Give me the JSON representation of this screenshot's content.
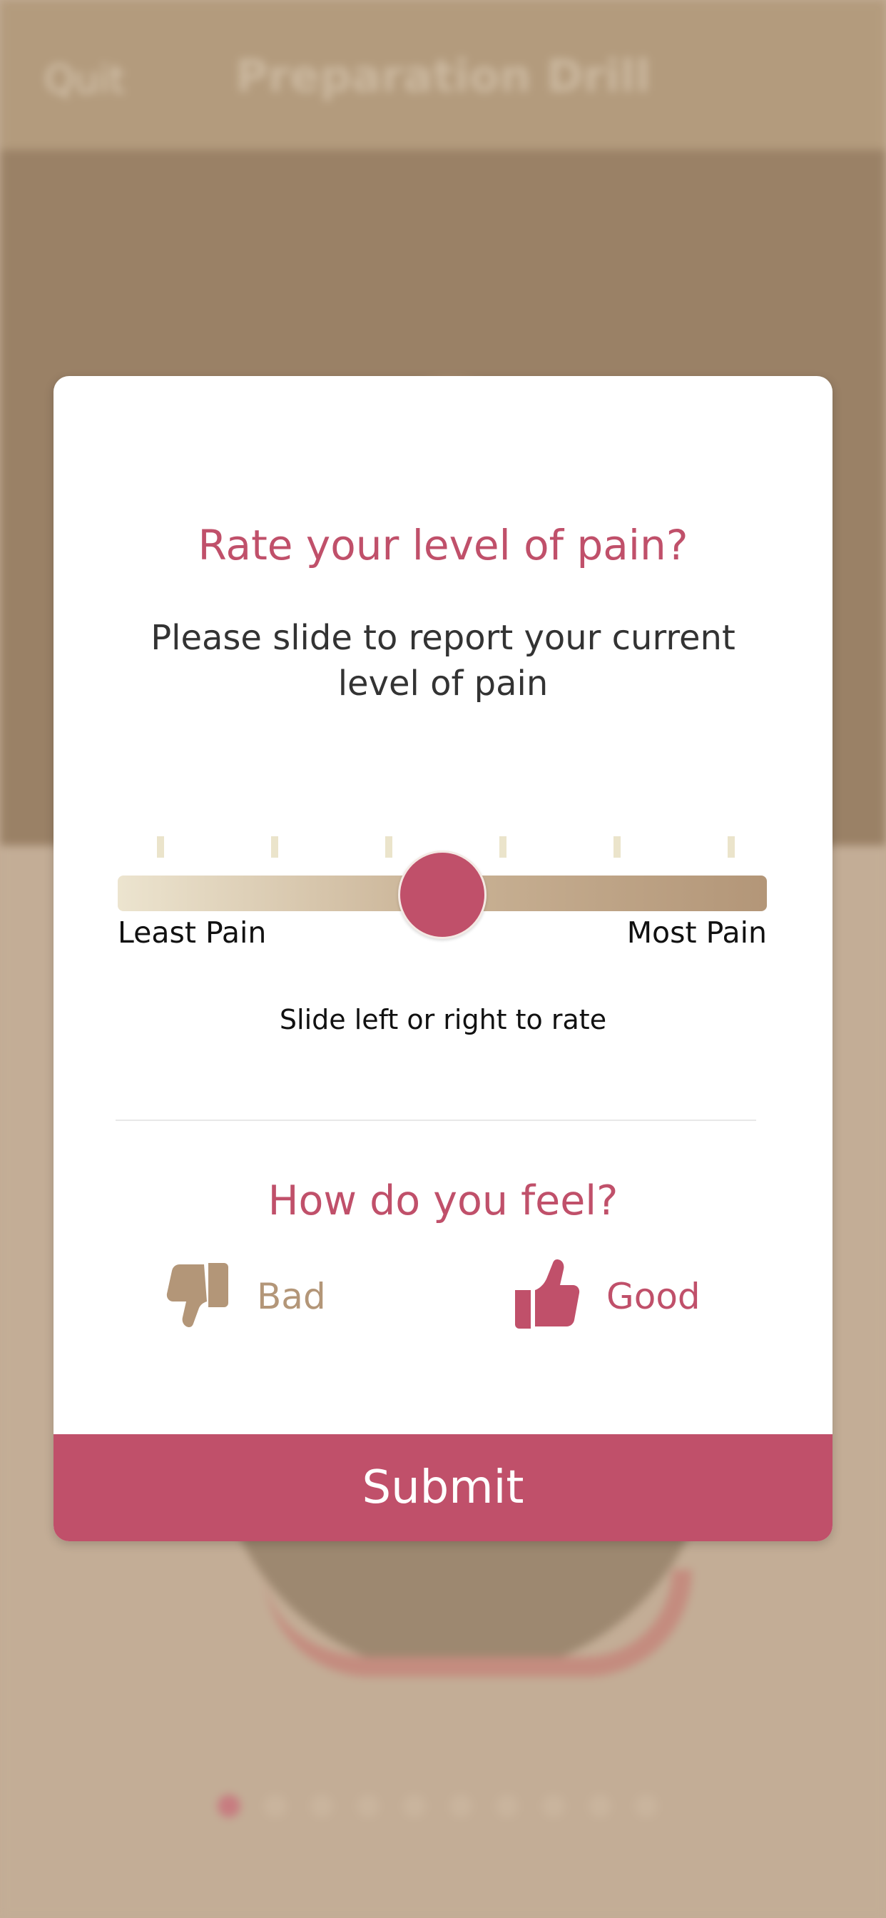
{
  "background": {
    "header": {
      "quit_label": "Quit",
      "title": "Preparation Drill"
    },
    "pager": {
      "total": 10,
      "active_index": 0
    }
  },
  "modal": {
    "title": "Rate your level of pain?",
    "subtitle": "Please slide to report your current level of pain",
    "slider": {
      "min_label": "Least Pain",
      "max_label": "Most Pain",
      "tick_count": 6,
      "value": 0.5,
      "hint": "Slide left or right to rate"
    },
    "feel": {
      "title": "How do you feel?",
      "bad_label": "Bad",
      "good_label": "Good",
      "selected": "good"
    },
    "submit_label": "Submit"
  },
  "colors": {
    "accent": "#c0506a",
    "tan": "#b39678",
    "overlay": "#c3ad96"
  },
  "icons": {
    "bad": "thumbs-down-icon",
    "good": "thumbs-up-icon"
  }
}
